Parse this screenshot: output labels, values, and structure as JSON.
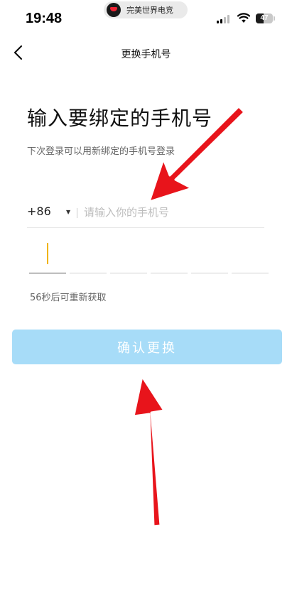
{
  "status_bar": {
    "time": "19:48",
    "app_name": "完美世界电竞",
    "battery": "47",
    "battery_level": 0.47
  },
  "nav": {
    "title": "更换手机号",
    "back_icon": "chevron-left-icon"
  },
  "page": {
    "heading": "输入要绑定的手机号",
    "subheading": "下次登录可以用新绑定的手机号登录"
  },
  "phone": {
    "country_code": "+86",
    "value": "",
    "placeholder": "请输入你的手机号"
  },
  "code": {
    "digits": [
      "",
      "",
      "",
      "",
      "",
      ""
    ],
    "countdown": "56秒后可重新获取"
  },
  "confirm_button": {
    "label": "确认更换",
    "enabled": false
  },
  "colors": {
    "button_disabled": "#a7dcf8",
    "cursor": "#f0b400",
    "annotation_arrow": "#e8141b"
  }
}
